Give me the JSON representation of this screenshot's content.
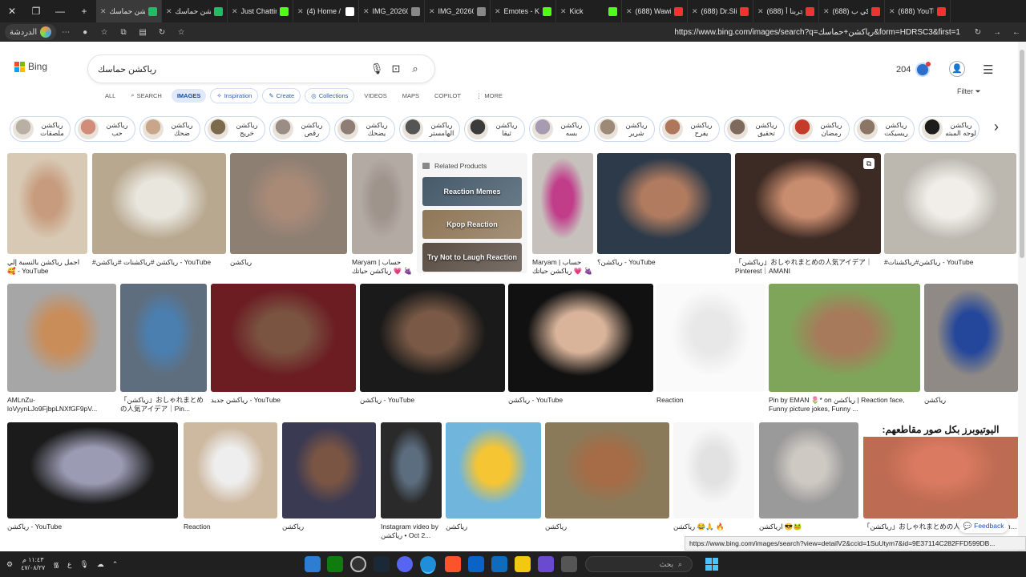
{
  "browser": {
    "tabs": [
      {
        "label": "رياكشن حماسك",
        "color": "#2b6"
      },
      {
        "label": "رياكشن حماسك",
        "color": "#2b6"
      },
      {
        "label": "Just Chatting",
        "color": "#53fc18"
      },
      {
        "label": "(4) Home / X",
        "color": "#fff"
      },
      {
        "label": "IMG_202602...",
        "color": "#888"
      },
      {
        "label": "IMG_202602...",
        "color": "#888"
      },
      {
        "label": "Emotes - Kick",
        "color": "#53fc18"
      },
      {
        "label": "Kick",
        "color": "#53fc18"
      },
      {
        "label": "(688) Wawi -",
        "color": "#e33"
      },
      {
        "label": "(688) Dr.Slim",
        "color": "#e33"
      },
      {
        "label": "(688) جربنا أ",
        "color": "#e33"
      },
      {
        "label": "(688) تشكي ب",
        "color": "#e33"
      },
      {
        "label": "(688) YouTube",
        "color": "#e33"
      }
    ],
    "new_tab": "+",
    "profile_label": "الدردشة",
    "url": "https://www.bing.com/images/search?q=رياكشن+حماسك&form=HDRSC3&first=1"
  },
  "bing": {
    "logo_text": "Bing",
    "query": "رياكشن حماسك",
    "points": "204",
    "filter_label": "Filter",
    "nav_tabs": [
      {
        "label": "ALL",
        "icon": ""
      },
      {
        "label": "SEARCH",
        "icon": "copilot-search-icon"
      },
      {
        "label": "IMAGES",
        "icon": ""
      },
      {
        "label": "Inspiration",
        "icon": "inspiration-icon"
      },
      {
        "label": "Create",
        "icon": "create-icon"
      },
      {
        "label": "Collections",
        "icon": "collections-icon"
      },
      {
        "label": "VIDEOS",
        "icon": ""
      },
      {
        "label": "MAPS",
        "icon": ""
      },
      {
        "label": "COPILOT",
        "icon": ""
      },
      {
        "label": "MORE",
        "icon": "more-dots-icon"
      }
    ],
    "related_searches": [
      {
        "l1": "رياكشن",
        "l2": "ملصقات",
        "color": "#b9b0a4"
      },
      {
        "l1": "رياكشن",
        "l2": "حب",
        "color": "#d28c7a"
      },
      {
        "l1": "رياكشن",
        "l2": "ضحك",
        "color": "#c9a58a"
      },
      {
        "l1": "رياكشن",
        "l2": "خريج",
        "color": "#7c6a4c"
      },
      {
        "l1": "رياكشن",
        "l2": "رقص",
        "color": "#9a8d86"
      },
      {
        "l1": "رياكشن",
        "l2": "يضحك",
        "color": "#8e7d74"
      },
      {
        "l1": "رياكشن",
        "l2": "الهامستر",
        "color": "#555"
      },
      {
        "l1": "رياكشن",
        "l2": "ثيقا",
        "color": "#3b3b3b"
      },
      {
        "l1": "رياكشن",
        "l2": "بسه",
        "color": "#a79bb1"
      },
      {
        "l1": "رياكشن",
        "l2": "شرير",
        "color": "#9d8a76"
      },
      {
        "l1": "رياكشن",
        "l2": "يفرح",
        "color": "#b0765c"
      },
      {
        "l1": "رياكشن",
        "l2": "تحقيق",
        "color": "#7e6a5d"
      },
      {
        "l1": "رياكشن",
        "l2": "رمضان",
        "color": "#c53b2a"
      },
      {
        "l1": "رياكشن",
        "l2": "ريسيكت",
        "color": "#8b7564"
      },
      {
        "l1": "رياكشن",
        "l2": "لوجه المبتسم",
        "color": "#1c1c1c"
      }
    ],
    "related_products": {
      "heading": "Related Products",
      "items": [
        {
          "label": "Reaction Memes",
          "color": "#455a6a"
        },
        {
          "label": "Kpop Reaction",
          "color": "#8f7758"
        },
        {
          "label": "Try Not to Laugh Reaction",
          "color": "#5b4e44"
        }
      ]
    },
    "row1": [
      {
        "caption": "اجمل رياكشن بالنسبة إلي 🥰 - YouTube",
        "two": true,
        "color": "#d8c9b4",
        "face": "#c79c7e"
      },
      {
        "caption": "#رياكشن #رياكشنات #رياكشن - YouTube",
        "two": false,
        "color": "#b8a890",
        "face": "#e9e6de"
      },
      {
        "caption": "رياكشن",
        "two": false,
        "color": "#8e7f73",
        "face": "#a88a77"
      },
      {
        "caption": "Maryam | حساب رياكشن حياتك 💗 🍇",
        "two": true,
        "color": "#b4aaa4",
        "face": "#9e948c"
      },
      {
        "caption": "Maryam | حساب رياكشن حياتك 💗 🍇",
        "two": true,
        "color": "#c7c1bd",
        "face": "#c13d8a"
      },
      {
        "caption": "رياكشن؟ - YouTube",
        "two": false,
        "color": "#2c3a49",
        "face": "#b07b5f"
      },
      {
        "caption": "「رياكشن」おしゃれまとめの人気アイデア｜Pinterest｜AMANI",
        "two": true,
        "color": "#3c2a24",
        "face": "#c88c6e"
      },
      {
        "caption": "#رياكشن#رياكشنات - YouTube",
        "two": false,
        "color": "#bcb8b0",
        "face": "#f1eeea"
      }
    ],
    "row2": [
      {
        "caption": "AMLnZu-loVyynLJo9FjbpLNXfGF9pV...",
        "two": true,
        "color": "#a6a6a6",
        "face": "#c98d5a"
      },
      {
        "caption": "「رياكشن」おしゃれまとめの人気アイデア｜Pin...",
        "two": true,
        "color": "#5f6e7e",
        "face": "#4a7fb0"
      },
      {
        "caption": "رياكشن جديد - YouTube",
        "two": false,
        "color": "#6b1d22",
        "face": "#7a5341"
      },
      {
        "caption": "رياكشن - YouTube",
        "two": false,
        "color": "#1a1a1a",
        "face": "#7a5a46"
      },
      {
        "caption": "رياكشن - YouTube",
        "two": false,
        "color": "#111",
        "face": "#d9b49a"
      },
      {
        "caption": "Reaction",
        "two": false,
        "color": "#fafafa",
        "face": "#e8e8e8"
      },
      {
        "caption": "Pin by EMAN 🌷* on رياكشن | Reaction face, Funny picture jokes, Funny ...",
        "two": true,
        "color": "#7fa55a",
        "face": "#a77a5b"
      },
      {
        "caption": "رياكشن",
        "two": false,
        "color": "#8f8a85",
        "face": "#24479b"
      }
    ],
    "row3": [
      {
        "caption": "رياكشن - YouTube",
        "two": false,
        "color": "#1b1b1b",
        "face": "#9b9bb4"
      },
      {
        "caption": "Reaction",
        "two": false,
        "color": "#cdb8a0",
        "face": "#eee"
      },
      {
        "caption": "رياكشن",
        "two": false,
        "color": "#3a3a52",
        "face": "#7a5544"
      },
      {
        "caption": "Instagram video by رياكشن • Oct 2...",
        "two": true,
        "color": "#2a2a2a",
        "face": "#5c6d7f"
      },
      {
        "caption": "رياكشن",
        "two": false,
        "color": "#6fb5dc",
        "face": "#f6c533"
      },
      {
        "caption": "رياكشن",
        "two": false,
        "color": "#8a7a5a",
        "face": "#a56c47"
      },
      {
        "caption": "رياكشن 😂🙏 🔥",
        "two": false,
        "color": "#f7f7f7",
        "face": "#e2e2e2"
      },
      {
        "caption": "ارياكشن 😎🐸",
        "two": false,
        "color": "#9a9a9a",
        "face": "#cfc9c3"
      },
      {
        "caption": "「رياكشن」おしゃれまとめの人気アイデア｜Pinterest｜S...",
        "two": false,
        "color": "#bd6b52",
        "face": "#d97a61"
      }
    ],
    "row3_banner": "اليوتيوبرز بكل صور مقاطعهم:",
    "feedback": "Feedback"
  },
  "status_url": "https://www.bing.com/images/search?view=detailV2&ccid=1SuUtym7&id=9E37114C282FFD599DB...",
  "taskbar": {
    "time": "١١:٤٣ م",
    "date": "٤٧/٠٨/٢٧",
    "search_label": "بحث",
    "lang": "ع"
  }
}
